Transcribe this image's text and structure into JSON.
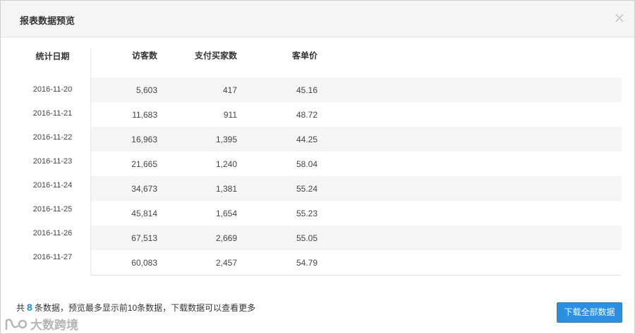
{
  "dialog": {
    "title": "报表数据预览",
    "close_glyph": "×"
  },
  "table": {
    "headers": {
      "date": "统计日期",
      "visitors": "访客数",
      "buyers": "支付买家数",
      "avg_price": "客单价"
    },
    "rows": [
      {
        "date": "2016-11-20",
        "visitors": "5,603",
        "buyers": "417",
        "avg_price": "45.16"
      },
      {
        "date": "2016-11-21",
        "visitors": "11,683",
        "buyers": "911",
        "avg_price": "48.72"
      },
      {
        "date": "2016-11-22",
        "visitors": "16,963",
        "buyers": "1,395",
        "avg_price": "44.25"
      },
      {
        "date": "2016-11-23",
        "visitors": "21,665",
        "buyers": "1,240",
        "avg_price": "58.04"
      },
      {
        "date": "2016-11-24",
        "visitors": "34,673",
        "buyers": "1,381",
        "avg_price": "55.24"
      },
      {
        "date": "2016-11-25",
        "visitors": "45,814",
        "buyers": "1,654",
        "avg_price": "55.23"
      },
      {
        "date": "2016-11-26",
        "visitors": "67,513",
        "buyers": "2,669",
        "avg_price": "55.05"
      },
      {
        "date": "2016-11-27",
        "visitors": "60,083",
        "buyers": "2,457",
        "avg_price": "54.79"
      }
    ]
  },
  "footer": {
    "prefix": "共",
    "count": "8",
    "suffix": "条数据，预览最多显示前10条数据，下载数据可以查看更多",
    "download_label": "下载全部数据"
  },
  "watermark": {
    "text": "大数跨境"
  },
  "colors": {
    "accent": "#2d8fe0",
    "count_highlight": "#1a8fd8",
    "stripe": "#f5f5f5"
  }
}
